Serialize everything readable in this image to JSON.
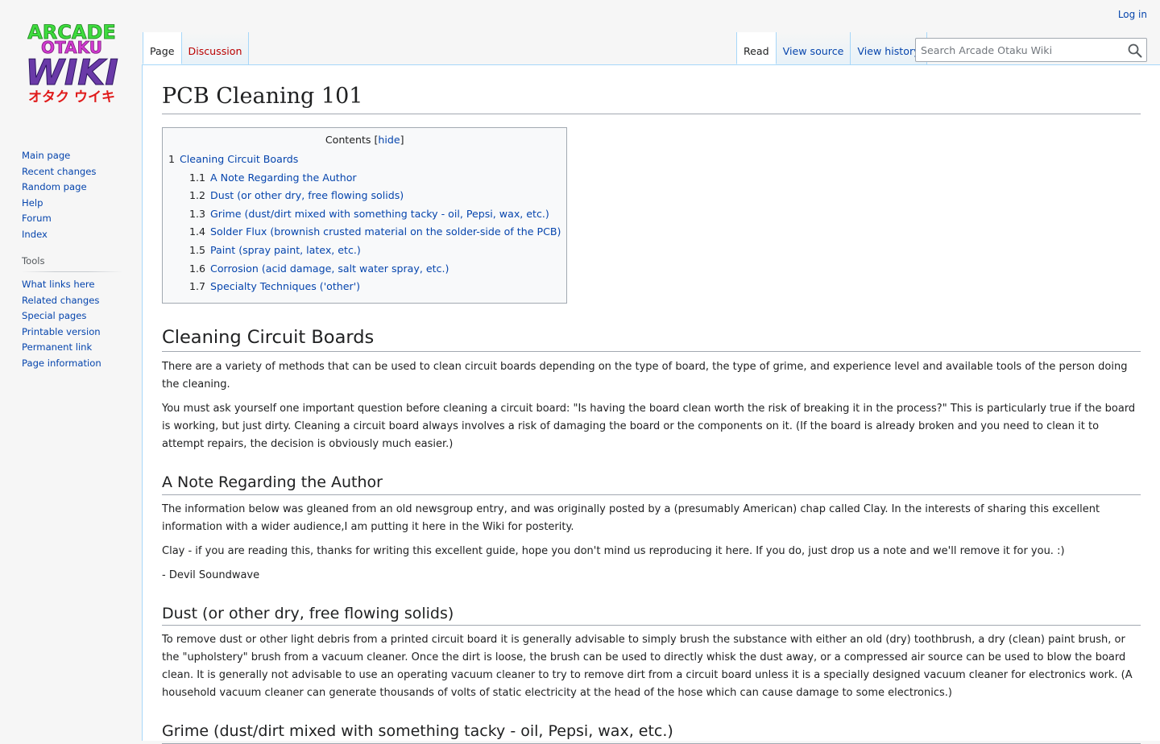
{
  "logo": {
    "line1": "ARCADE",
    "line2": "OTAKU",
    "line3": "WIKI",
    "line4": "オタク ウイキ",
    "colors": {
      "arcade": "#3ddc3d",
      "otaku": "#d13ad1",
      "wiki": "#6a3aa8",
      "katakana": "#e01b1b"
    }
  },
  "personal": {
    "login": "Log in"
  },
  "tabs": {
    "left": [
      "Page",
      "Discussion"
    ],
    "right": [
      "Read",
      "View source",
      "View history"
    ]
  },
  "search": {
    "placeholder": "Search Arcade Otaku Wiki"
  },
  "sidebar": {
    "navigation": [
      "Main page",
      "Recent changes",
      "Random page",
      "Help",
      "Forum",
      "Index"
    ],
    "tools_heading": "Tools",
    "tools": [
      "What links here",
      "Related changes",
      "Special pages",
      "Printable version",
      "Permanent link",
      "Page information"
    ]
  },
  "page": {
    "title": "PCB Cleaning 101",
    "toc": {
      "title": "Contents",
      "toggle": "hide",
      "items": [
        {
          "num": "1",
          "text": "Cleaning Circuit Boards"
        },
        {
          "num": "1.1",
          "text": "A Note Regarding the Author"
        },
        {
          "num": "1.2",
          "text": "Dust (or other dry, free flowing solids)"
        },
        {
          "num": "1.3",
          "text": "Grime (dust/dirt mixed with something tacky - oil, Pepsi, wax, etc.)"
        },
        {
          "num": "1.4",
          "text": "Solder Flux (brownish crusted material on the solder-side of the PCB)"
        },
        {
          "num": "1.5",
          "text": "Paint (spray paint, latex, etc.)"
        },
        {
          "num": "1.6",
          "text": "Corrosion (acid damage, salt water spray, etc.)"
        },
        {
          "num": "1.7",
          "text": "Specialty Techniques ('other')"
        }
      ]
    },
    "sections": {
      "cleaning": {
        "heading": "Cleaning Circuit Boards",
        "p1": "There are a variety of methods that can be used to clean circuit boards depending on the type of board, the type of grime, and experience level and available tools of the person doing the cleaning.",
        "p2": "You must ask yourself one important question before cleaning a circuit board: \"Is having the board clean worth the risk of breaking it in the process?\" This is particularly true if the board is working, but just dirty. Cleaning a circuit board always involves a risk of damaging the board or the components on it. (If the board is already broken and you need to clean it to attempt repairs, the decision is obviously much easier.)"
      },
      "author": {
        "heading": "A Note Regarding the Author",
        "p1": "The information below was gleaned from an old newsgroup entry, and was originally posted by a (presumably American) chap called Clay. In the interests of sharing this excellent information with a wider audience,I am putting it here in the Wiki for posterity.",
        "p2": "Clay - if you are reading this, thanks for writing this excellent guide, hope you don't mind us reproducing it here. If you do, just drop us a note and we'll remove it for you. :)",
        "p3": "- Devil Soundwave"
      },
      "dust": {
        "heading": "Dust (or other dry, free flowing solids)",
        "p1": "To remove dust or other light debris from a printed circuit board it is generally advisable to simply brush the substance with either an old (dry) toothbrush, a dry (clean) paint brush, or the \"upholstery\" brush from a vacuum cleaner. Once the dirt is loose, the brush can be used to directly whisk the dust away, or a compressed air source can be used to blow the board clean. It is generally not advisable to use an operating vacuum cleaner to try to remove dirt from a circuit board unless it is a specially designed vacuum cleaner for electronics work. (A household vacuum cleaner can generate thousands of volts of static electricity at the head of the hose which can cause damage to some electronics.)"
      },
      "grime": {
        "heading": "Grime (dust/dirt mixed with something tacky - oil, Pepsi, wax, etc.)"
      }
    }
  }
}
